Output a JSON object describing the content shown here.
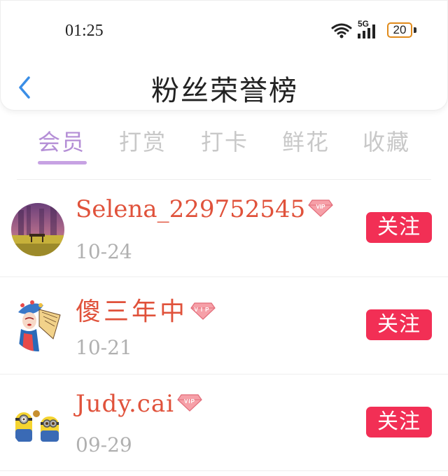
{
  "status_bar": {
    "time": "01:25",
    "network": "5G",
    "battery": "20"
  },
  "header": {
    "title": "粉丝荣誉榜"
  },
  "tabs": [
    {
      "label": "会员",
      "active": true
    },
    {
      "label": "打赏",
      "active": false
    },
    {
      "label": "打卡",
      "active": false
    },
    {
      "label": "鲜花",
      "active": false
    },
    {
      "label": "收藏",
      "active": false
    }
  ],
  "users": [
    {
      "name": "Selena_229752545",
      "date": "10-24",
      "badge": "VIP",
      "follow_label": "关注"
    },
    {
      "name": "傻三年中",
      "date": "10-21",
      "badge": "VIP",
      "follow_label": "关注"
    },
    {
      "name": "Judy.cai",
      "date": "09-29",
      "badge": "VIP",
      "follow_label": "关注"
    }
  ],
  "colors": {
    "accent_tab": "#b48ed6",
    "name": "#e0523b",
    "follow_button": "#f22f55",
    "back_arrow": "#3a8ee6"
  }
}
